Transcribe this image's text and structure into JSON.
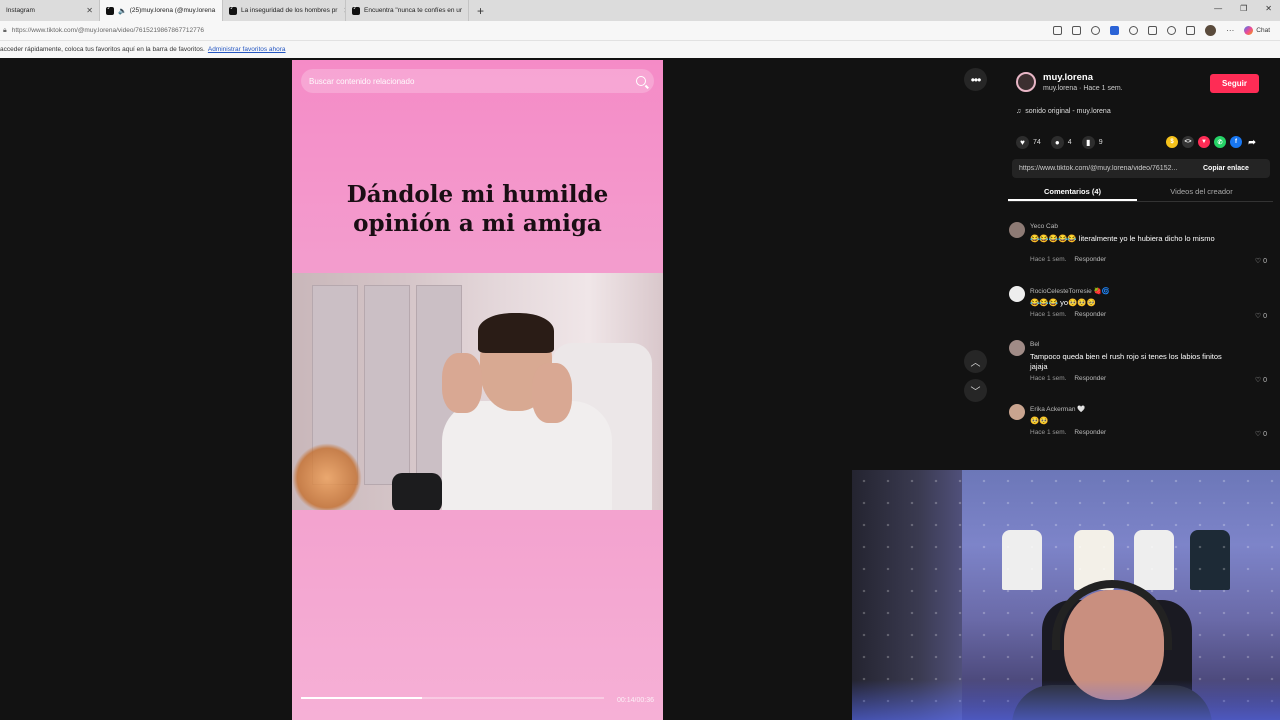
{
  "browser": {
    "tabs": [
      {
        "label": "Instagram",
        "active": false
      },
      {
        "label": "(25)muy.lorena (@muy.lorena",
        "active": true
      },
      {
        "label": "La inseguridad de los hombres pr",
        "active": false
      },
      {
        "label": "Encuentra \"nunca te confíes en ur",
        "active": false
      }
    ],
    "url": "https://www.tiktok.com/@muy.lorena/video/7615219867867712776",
    "chat_label": "Chat",
    "favbar_text": "acceder rápidamente, coloca tus favoritos aquí en la barra de favoritos.",
    "favbar_link": "Administrar favoritos ahora"
  },
  "video": {
    "search_placeholder": "Buscar contenido relacionado",
    "caption": "Dándole mi humilde\nopinión a mi amiga",
    "time": "00:14/00:36",
    "progress": 0.4
  },
  "post": {
    "author": "muy.lorena",
    "author_sub": "muy.lorena · Hace 1 sem.",
    "follow_label": "Seguir",
    "sound": "sonido original - muy.lorena",
    "likes": "74",
    "comments": "4",
    "saves": "9",
    "link": "https://www.tiktok.com/@muy.lorena/video/76152...",
    "copy_label": "Copiar enlace",
    "tab_comments": "Comentarios (4)",
    "tab_creator": "Videos del creador"
  },
  "comments": [
    {
      "name": "Yeco Cab",
      "text": "😂😂😂😂😂 literalmente yo le hubiera dicho lo mismo",
      "time": "Hace 1 sem.",
      "reply": "Responder",
      "likes": "0"
    },
    {
      "name": "RocioCelesteTorresie 🍓🌀",
      "text": "😂😂😂 yo🥺🥺🥺",
      "time": "Hace 1 sem.",
      "reply": "Responder",
      "likes": "0"
    },
    {
      "name": "Bel",
      "text": "Tampoco queda bien el rush rojo si tenes los labios finitos jajaja",
      "time": "Hace 1 sem.",
      "reply": "Responder",
      "likes": "0"
    },
    {
      "name": "Erika Ackerman 🤍",
      "text": "🥺🥺",
      "time": "Hace 1 sem.",
      "reply": "Responder",
      "likes": "0"
    }
  ],
  "colors": {
    "follow": "#fe2c55",
    "video_bg": "#f39ccd"
  }
}
